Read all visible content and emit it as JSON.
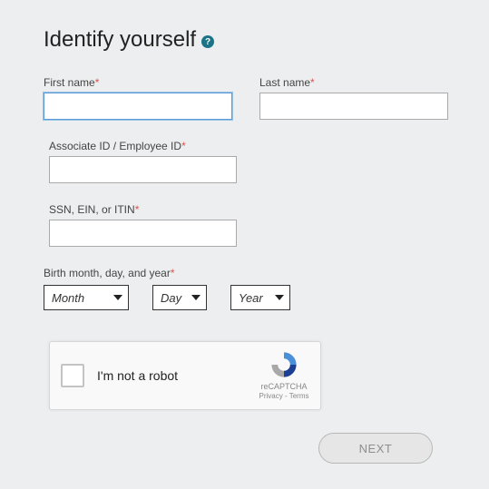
{
  "title": "Identify yourself",
  "help_icon_glyph": "?",
  "first_name": {
    "label": "First name",
    "value": ""
  },
  "last_name": {
    "label": "Last name",
    "value": ""
  },
  "associate_id": {
    "label": "Associate ID / Employee ID",
    "value": ""
  },
  "ssn": {
    "label": "SSN, EIN, or ITIN",
    "value": ""
  },
  "birth": {
    "label": "Birth month, day, and year",
    "month": "Month",
    "day": "Day",
    "year": "Year"
  },
  "captcha": {
    "text": "I'm not a robot",
    "brand": "reCAPTCHA",
    "links": "Privacy - Terms"
  },
  "next_label": "NEXT"
}
